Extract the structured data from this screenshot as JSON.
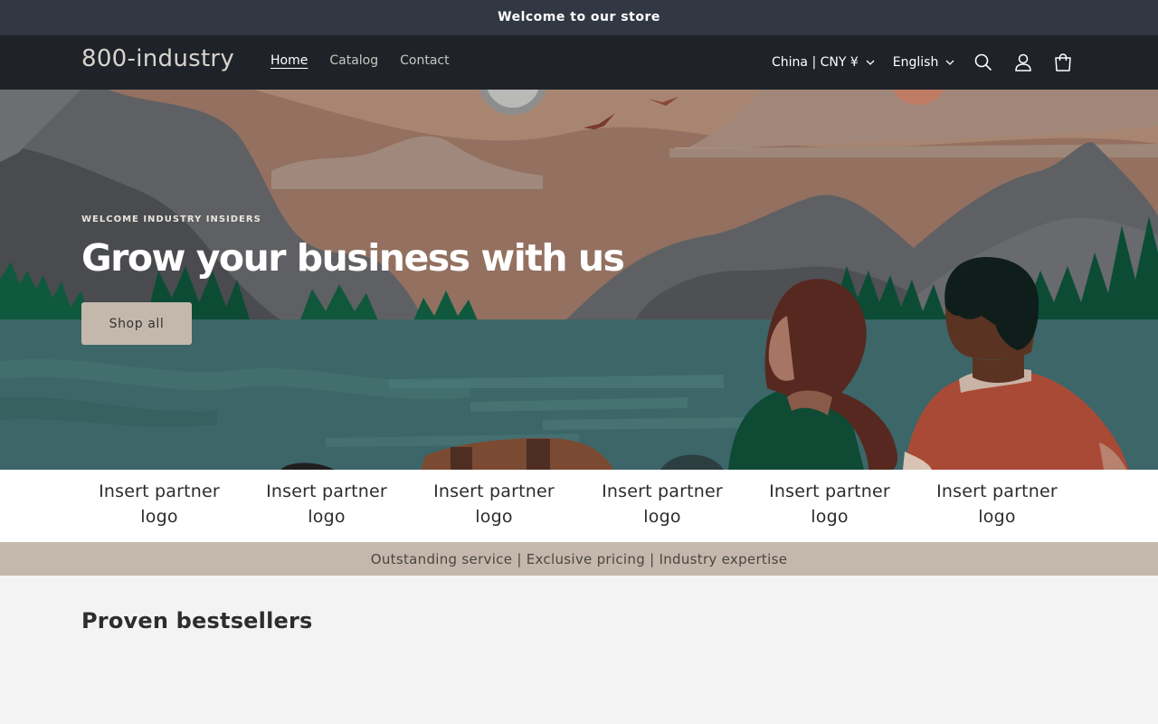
{
  "announcement": {
    "text": "Welcome to our store"
  },
  "header": {
    "logo": "800-industry",
    "nav": [
      {
        "label": "Home",
        "active": true
      },
      {
        "label": "Catalog",
        "active": false
      },
      {
        "label": "Contact",
        "active": false
      }
    ],
    "country_selector": "China | CNY ¥",
    "language_selector": "English",
    "icons": [
      "search-icon",
      "account-icon",
      "cart-icon"
    ]
  },
  "hero": {
    "eyebrow": "WELCOME INDUSTRY INSIDERS",
    "title": "Grow your business with us",
    "button_label": "Shop all"
  },
  "partners": [
    "Insert partner logo",
    "Insert partner logo",
    "Insert partner logo",
    "Insert partner logo",
    "Insert partner logo",
    "Insert partner logo"
  ],
  "tagline": "Outstanding service | Exclusive pricing | Industry expertise",
  "section": {
    "title": "Proven bestsellers"
  },
  "colors": {
    "announcement_bg": "#323843",
    "header_bg": "#1f2329",
    "accent_beige": "#c4b8ac",
    "page_bg": "#f3f3f3"
  }
}
